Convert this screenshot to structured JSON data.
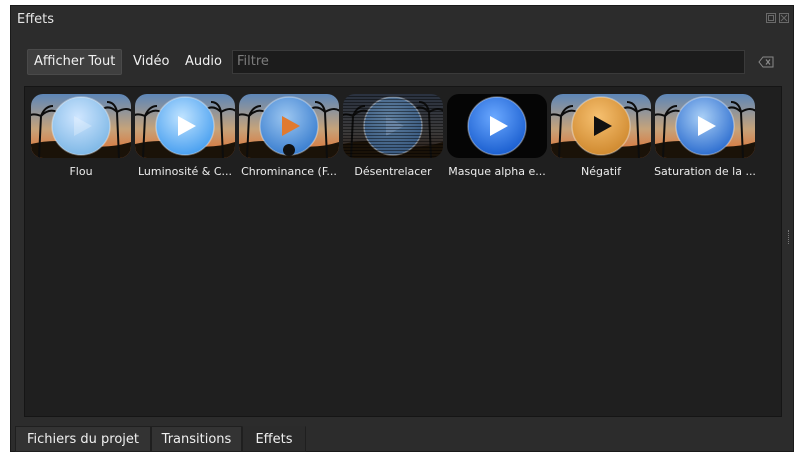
{
  "window": {
    "title": "Effets"
  },
  "toolbar": {
    "show_all_label": "Afficher Tout",
    "video_label": "Vidéo",
    "audio_label": "Audio",
    "filter_placeholder": "Filtre"
  },
  "effects": [
    {
      "label": "Flou",
      "style": "blur"
    },
    {
      "label": "Luminosité & C...",
      "style": "bright"
    },
    {
      "label": "Chrominance (F...",
      "style": "chroma"
    },
    {
      "label": "Désentrelacer",
      "style": "deinterlace"
    },
    {
      "label": "Masque alpha e...",
      "style": "alpha"
    },
    {
      "label": "Négatif",
      "style": "negative"
    },
    {
      "label": "Saturation de la ...",
      "style": "saturation"
    }
  ],
  "bottom_tabs": [
    {
      "label": "Fichiers du projet",
      "active": false
    },
    {
      "label": "Transitions",
      "active": false
    },
    {
      "label": "Effets",
      "active": true
    }
  ]
}
